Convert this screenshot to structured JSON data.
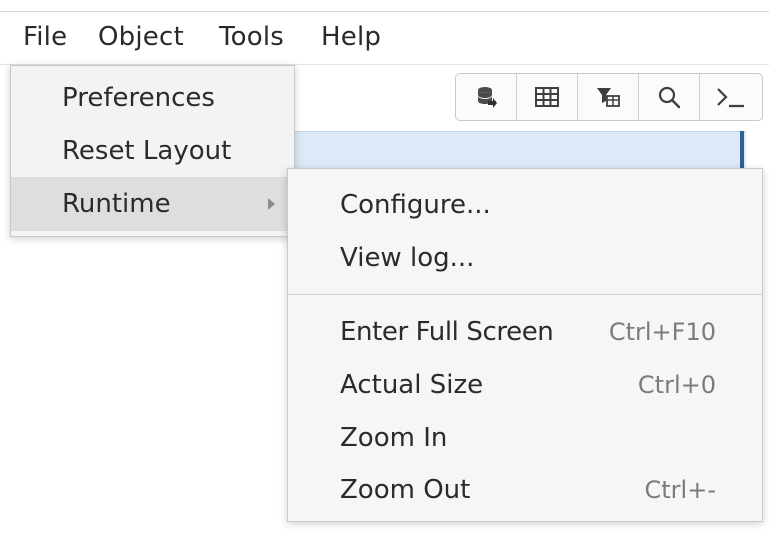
{
  "menubar": {
    "items": [
      {
        "label": "File"
      },
      {
        "label": "Object"
      },
      {
        "label": "Tools"
      },
      {
        "label": "Help"
      }
    ]
  },
  "toolbar": {
    "buttons": [
      {
        "icon": "database-icon"
      },
      {
        "icon": "table-icon"
      },
      {
        "icon": "table-filter-icon"
      },
      {
        "icon": "search-icon"
      },
      {
        "icon": "terminal-icon"
      }
    ]
  },
  "help_menu": {
    "items": [
      {
        "label": "Preferences"
      },
      {
        "label": "Reset Layout"
      },
      {
        "label": "Runtime"
      }
    ]
  },
  "runtime_submenu": {
    "items": [
      {
        "label": "Configure..."
      },
      {
        "label": "View log..."
      },
      {
        "label": "Enter Full Screen",
        "shortcut": "Ctrl+F10"
      },
      {
        "label": "Actual Size",
        "shortcut": "Ctrl+0"
      },
      {
        "label": "Zoom In",
        "shortcut": ""
      },
      {
        "label": "Zoom Out",
        "shortcut": "Ctrl+-"
      }
    ]
  }
}
